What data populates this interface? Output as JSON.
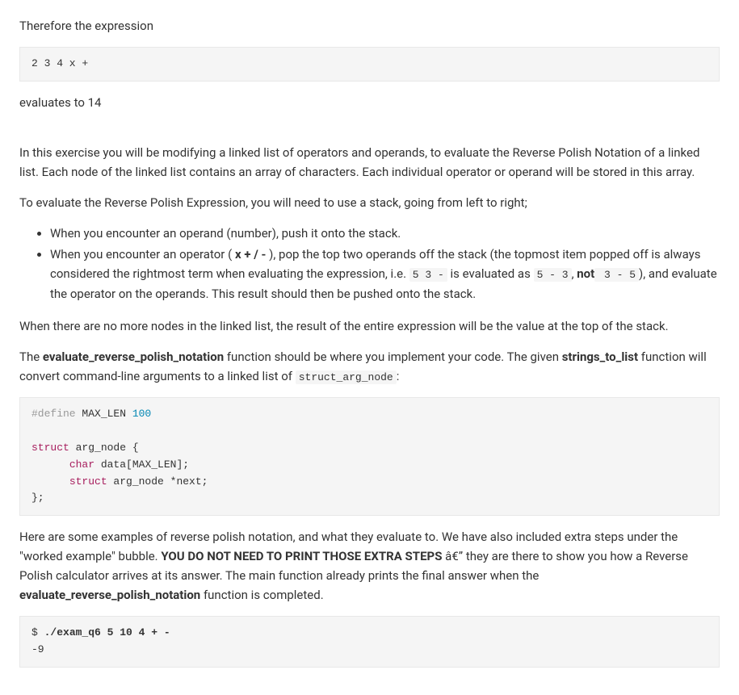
{
  "intro": {
    "therefore": "Therefore the expression",
    "expr1": "2 3 4 x +",
    "evaluates": "evaluates to 14"
  },
  "para1": "In this exercise you will be modifying a linked list of operators and operands, to evaluate the Reverse Polish Notation of a linked list. Each node of the linked list contains an array of characters. Each individual operator or operand will be stored in this array.",
  "para2": "To evaluate the Reverse Polish Expression, you will need to use a stack, going from left to right;",
  "bullets": {
    "b1": "When you encounter an operand (number), push it onto the stack.",
    "b2a": "When you encounter an operator ( ",
    "b2_ops": "x + / -",
    "b2b": " ), pop the top two operands off the stack (the topmost item popped off is always considered the rightmost term when evaluating the expression, i.e. ",
    "b2_ex1": "5 3 -",
    "b2c": " is evaluated as ",
    "b2_ex2": "5 - 3",
    "b2d": ", ",
    "b2_not": "not",
    "b2_ex3": " 3 - 5",
    "b2e": "), and evaluate the operator on the operands. This result should then be pushed onto the stack."
  },
  "para3": "When there are no more nodes in the linked list, the result of the entire expression will be the value at the top of the stack.",
  "para4": {
    "a": "The ",
    "fn1": "evaluate_reverse_polish_notation",
    "b": " function should be where you implement your code. The given ",
    "fn2": "strings_to_list",
    "c": " function will convert command-line arguments to a linked list of ",
    "code": "struct_arg_node",
    "d": ":"
  },
  "struct_code": {
    "line1_a": "#define",
    "line1_b": " MAX_LEN ",
    "line1_c": "100",
    "line3_a": "struct",
    "line3_b": " arg_node {",
    "line4_a": "      ",
    "line4_b": "char",
    "line4_c": " data[MAX_LEN];",
    "line5_a": "      ",
    "line5_b": "struct",
    "line5_c": " arg_node *next;",
    "line6": "};"
  },
  "para5": {
    "a": "Here are some examples of reverse polish notation, and what they evaluate to. We have also included extra steps under the \"worked example\" bubble. ",
    "bold": "YOU DO NOT NEED TO PRINT THOSE EXTRA STEPS",
    "b": " â€” they are there to show you how a Reverse Polish calculator arrives at its answer. The main function already prints the final answer when the ",
    "fn": "evaluate_reverse_polish_notation",
    "c": " function is completed."
  },
  "example": {
    "prompt": "$ ",
    "cmd": "./exam_q6 5 10 4 + -",
    "result": "-9"
  }
}
